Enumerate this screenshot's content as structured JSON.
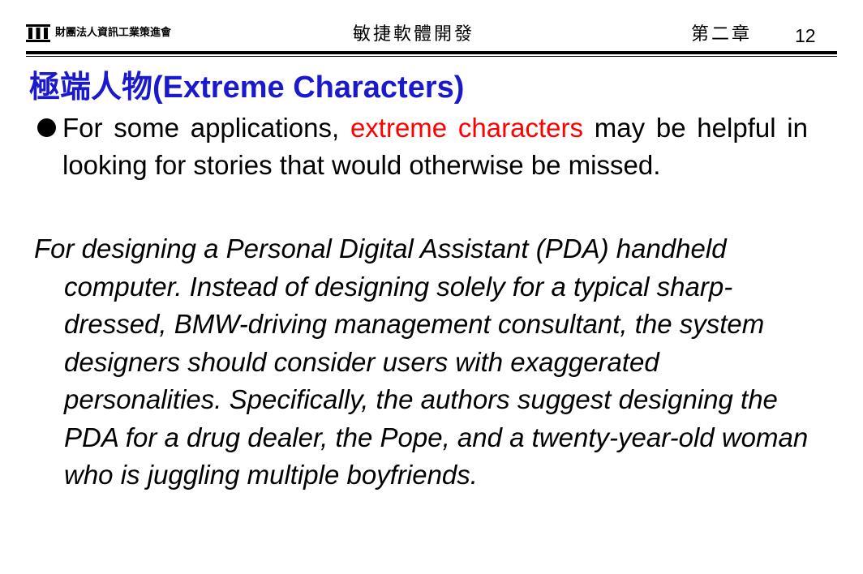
{
  "header": {
    "organization": "財團法人資訊工業策進會",
    "course_title": "敏捷軟體開發",
    "chapter": "第二章",
    "page_number": "12"
  },
  "slide": {
    "title_zh": "極端人物",
    "title_en": "(Extreme Characters)",
    "bullet": {
      "text_before": "For some applications, ",
      "highlight": "extreme characters",
      "text_after": " may be helpful in looking for stories that would otherwise be missed."
    },
    "example": "For designing a Personal Digital Assistant (PDA) handheld computer. Instead of designing solely for a typical sharp-dressed, BMW-driving management consultant, the system designers should consider users with exaggerated personalities. Specifically, the authors suggest designing the PDA for a drug dealer, the Pope, and a twenty-year-old woman who is juggling multiple boyfriends."
  },
  "colors": {
    "title": "#1a1acc",
    "highlight": "#ff0000",
    "text": "#000000"
  },
  "icons": {
    "logo": "institute-building-icon",
    "bullet": "filled-circle-bullet"
  }
}
